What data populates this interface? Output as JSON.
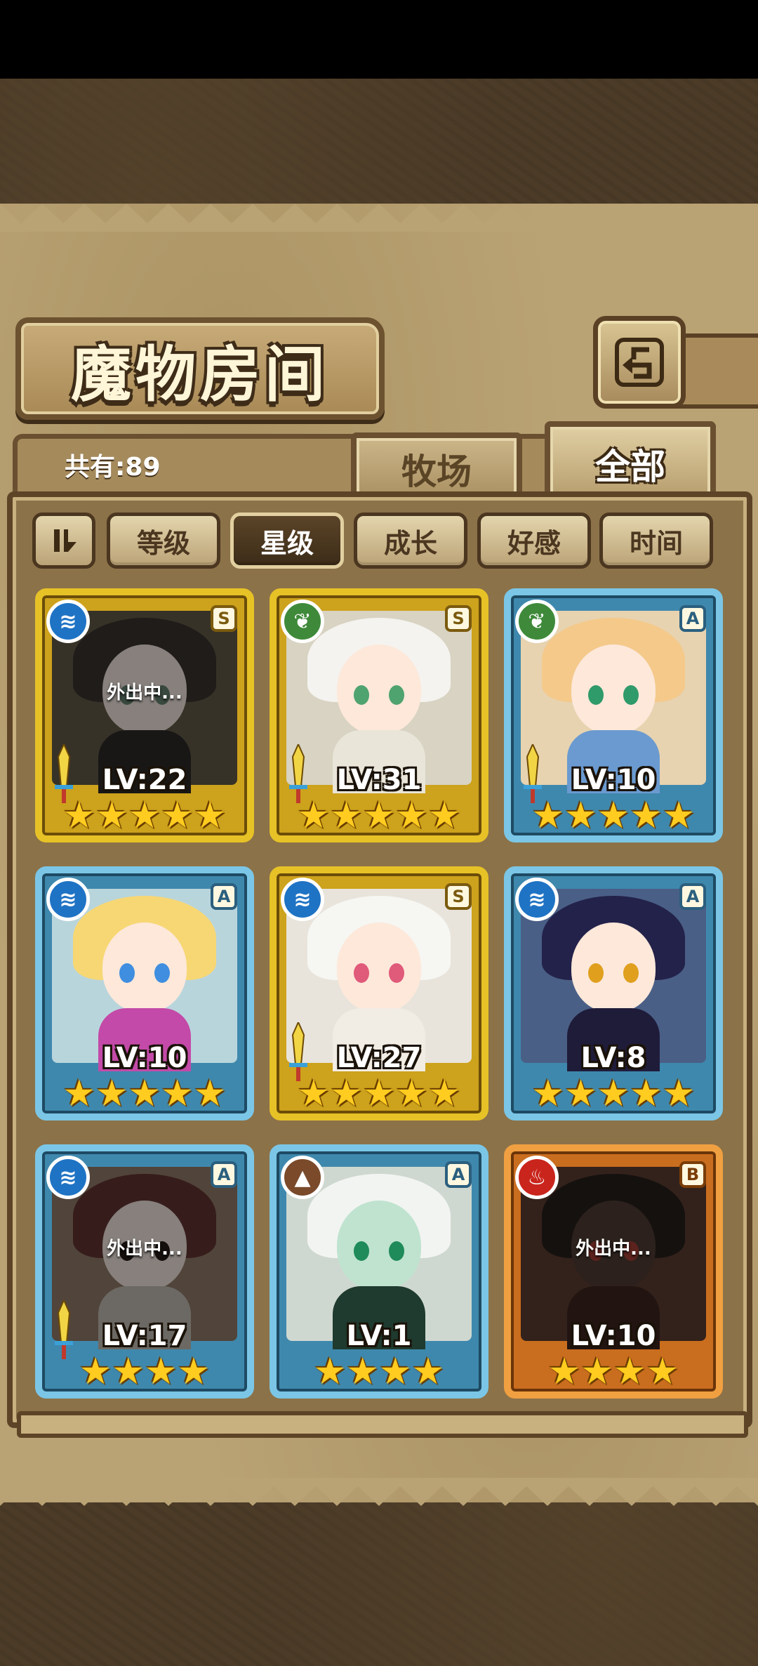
{
  "header": {
    "title": "魔物房间"
  },
  "summary": {
    "count_label": "共有:89"
  },
  "tabs": [
    {
      "label": "牧场"
    },
    {
      "label": "全部"
    }
  ],
  "sort": {
    "options": [
      {
        "label": "等级"
      },
      {
        "label": "星级"
      },
      {
        "label": "成长"
      },
      {
        "label": "好感"
      },
      {
        "label": "时间"
      }
    ],
    "active": "星级"
  },
  "monsters": [
    {
      "level": "LV:22",
      "rank": "S",
      "element": "water",
      "stars": "★★★★★",
      "status": "外出中...",
      "frame": "gold"
    },
    {
      "level": "LV:31",
      "rank": "S",
      "element": "grass",
      "stars": "★★★★★",
      "status": "",
      "frame": "gold"
    },
    {
      "level": "LV:10",
      "rank": "A",
      "element": "grass",
      "stars": "★★★★★",
      "status": "",
      "frame": "blue"
    },
    {
      "level": "LV:10",
      "rank": "A",
      "element": "water",
      "stars": "★★★★★",
      "status": "",
      "frame": "blue"
    },
    {
      "level": "LV:27",
      "rank": "S",
      "element": "water",
      "stars": "★★★★★",
      "status": "",
      "frame": "gold"
    },
    {
      "level": "LV:8",
      "rank": "A",
      "element": "water",
      "stars": "★★★★★",
      "status": "",
      "frame": "blue"
    },
    {
      "level": "LV:17",
      "rank": "A",
      "element": "water",
      "stars": "★★★★",
      "status": "外出中...",
      "frame": "blue"
    },
    {
      "level": "LV:1",
      "rank": "A",
      "element": "earth",
      "stars": "★★★★",
      "status": "",
      "frame": "blue"
    },
    {
      "level": "LV:10",
      "rank": "B",
      "element": "fire",
      "stars": "★★★★",
      "status": "外出中...",
      "frame": "orange"
    }
  ]
}
